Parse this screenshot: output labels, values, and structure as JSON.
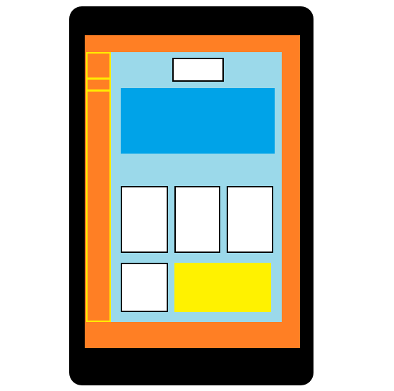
{
  "colors": {
    "device_body": "#000000",
    "frame": "#ff7f24",
    "sidebar_border": "#ffee00",
    "screen_background": "#9bd9ea",
    "hero_panel": "#00a3e8",
    "tile_fill": "#ffffff",
    "tile_border": "#000000",
    "highlight_block": "#fff200"
  },
  "components": {
    "sidebar_segments": 3,
    "content_tiles_top_row": 3,
    "content_tiles_bottom_row": 1,
    "highlight_blocks": 1
  }
}
